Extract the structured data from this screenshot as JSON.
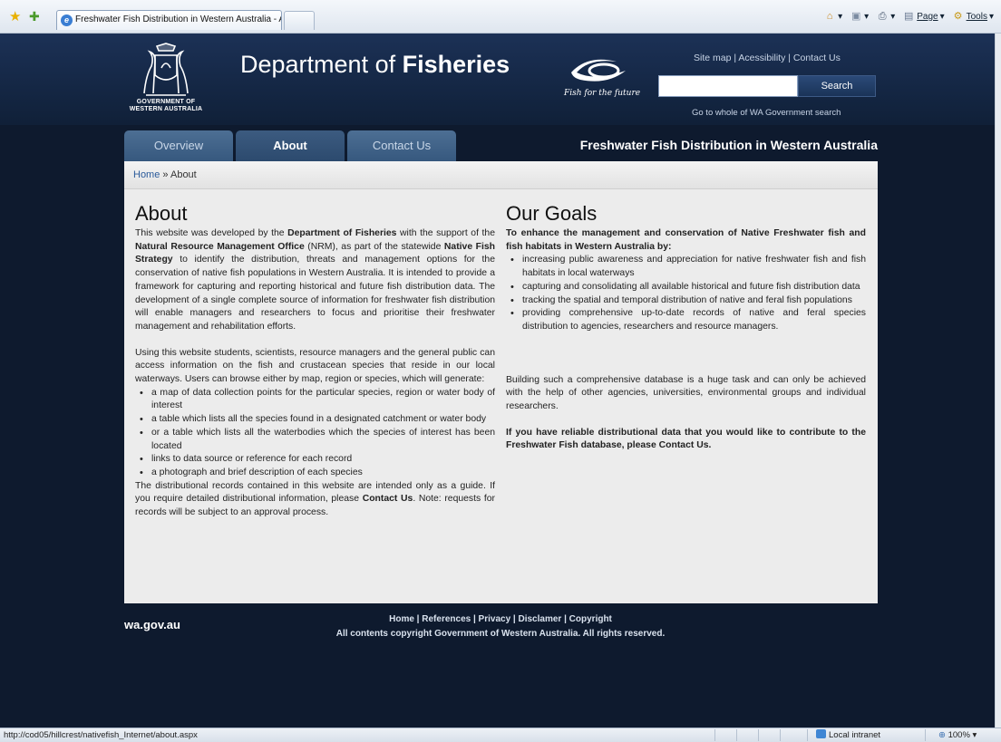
{
  "browser": {
    "tab_title": "Freshwater Fish Distribution in Western Australia - Ab...",
    "toolbar": {
      "page_label": "Page",
      "tools_label": "Tools"
    },
    "status_url": "http://cod05/hillcrest/nativefish_Internet/about.aspx",
    "zone": "Local intranet",
    "zoom": "100%"
  },
  "header": {
    "crest_line1": "GOVERNMENT OF",
    "crest_line2": "WESTERN AUSTRALIA",
    "title_light": "Department of ",
    "title_bold": "Fisheries",
    "logo_tagline": "Fish for the future",
    "util_links": [
      "Site map",
      "Acessibility",
      "Contact Us"
    ],
    "search_placeholder": "",
    "search_button": "Search",
    "wa_gov_search": "Go to whole of WA Government search"
  },
  "nav": {
    "tabs": [
      {
        "label": "Overview",
        "active": false
      },
      {
        "label": "About",
        "active": true
      },
      {
        "label": "Contact Us",
        "active": false
      }
    ],
    "site_heading": "Freshwater Fish Distribution in Western Australia"
  },
  "breadcrumb": {
    "home": "Home",
    "separator": "»",
    "current": "About"
  },
  "about": {
    "heading": "About",
    "p1": [
      {
        "t": "This website was developed by the "
      },
      {
        "t": "Department of Fisheries",
        "b": true
      },
      {
        "t": " with the support of the "
      },
      {
        "t": "Natural Resource Management Office",
        "b": true
      },
      {
        "t": " (NRM), as part of the statewide "
      },
      {
        "t": "Native Fish Strategy",
        "b": true
      },
      {
        "t": " to identify the distribution, threats and management options for the conservation of native fish populations in Western Australia. It is intended to provide a framework for capturing and reporting historical and future fish distribution data. The development of a single complete source of information for freshwater fish distribution will enable managers and researchers to focus and prioritise their freshwater management and rehabilitation efforts."
      }
    ],
    "p2": "Using this website students, scientists, resource managers and the general public can access information on the fish and crustacean species that reside in our local waterways. Users can browse either by map, region or species, which will generate:",
    "bullets": [
      "a map of data collection points for the particular species, region or water body of interest",
      "a table which lists all the species found in a designated catchment or water body",
      "or a table which lists all the waterbodies which the species of interest has been located",
      "links to data source or reference for each record",
      "a photograph and brief description of each species"
    ],
    "p3": [
      {
        "t": "The distributional records contained in this website are intended only as a guide. If you require detailed distributional information, please "
      },
      {
        "t": "Contact Us",
        "b": true
      },
      {
        "t": ". Note: requests for records will be subject to an approval process."
      }
    ]
  },
  "goals": {
    "heading": "Our Goals",
    "intro": "To enhance the management and conservation of Native Freshwater fish and fish habitats in Western Australia by:",
    "bullets": [
      "increasing public awareness and appreciation for native freshwater fish and fish habitats in local waterways",
      "capturing and consolidating all available historical and future fish distribution data",
      "tracking the spatial and temporal distribution of native and feral fish populations",
      "providing comprehensive up-to-date records of native and feral species distribution to agencies, researchers and resource managers."
    ],
    "p2": "Building such a comprehensive database is a huge task and can only be achieved with the help of other agencies, universities, environmental groups and individual researchers.",
    "p3": [
      {
        "t": "If you have reliable distributional data that you would like to contribute to the Freshwater Fish database, please "
      },
      {
        "t": "Contact Us.",
        "b": true
      }
    ]
  },
  "footer": {
    "logo": "wa.gov.au",
    "links": [
      "Home",
      "References",
      "Privacy",
      "Disclamer",
      "Copyright"
    ],
    "copyright": "All contents copyright Government of Western Australia. All rights reserved."
  }
}
